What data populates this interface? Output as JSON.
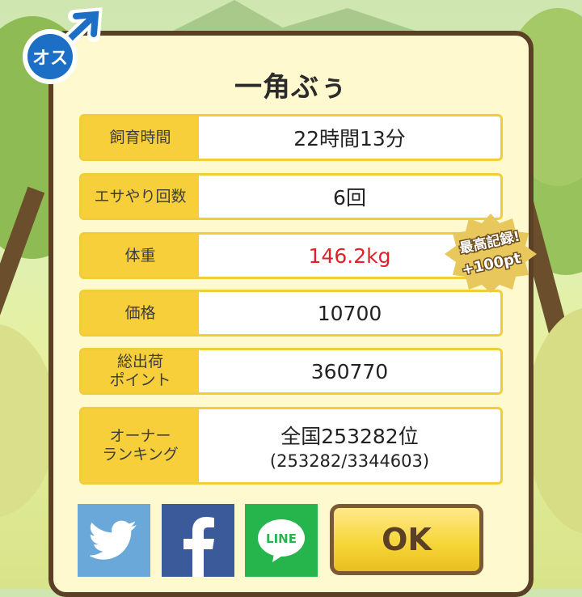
{
  "pig_name": "一角ぶぅ",
  "gender_badge": {
    "label": "オス",
    "icon": "male-symbol-icon",
    "color": "#1c6fc4"
  },
  "stats": [
    {
      "label": "飼育時間",
      "value": "22時間13分"
    },
    {
      "label": "エサやり回数",
      "value": "6回"
    },
    {
      "label": "体重",
      "value": "146.2kg",
      "highlight_color": "#e0202a"
    },
    {
      "label": "価格",
      "value": "10700"
    },
    {
      "label": "総出荷\nポイント",
      "value": "360770"
    },
    {
      "label": "オーナー\nランキング",
      "value": "全国253282位",
      "sub": "(253282/3344603)"
    }
  ],
  "record_badge": {
    "line1": "最高記録!",
    "line2": "+100pt"
  },
  "share": [
    {
      "name": "twitter",
      "icon": "twitter-bird-icon"
    },
    {
      "name": "facebook",
      "icon": "facebook-f-icon"
    },
    {
      "name": "line",
      "icon": "line-logo-icon",
      "text": "LINE"
    }
  ],
  "ok_label": "OK"
}
